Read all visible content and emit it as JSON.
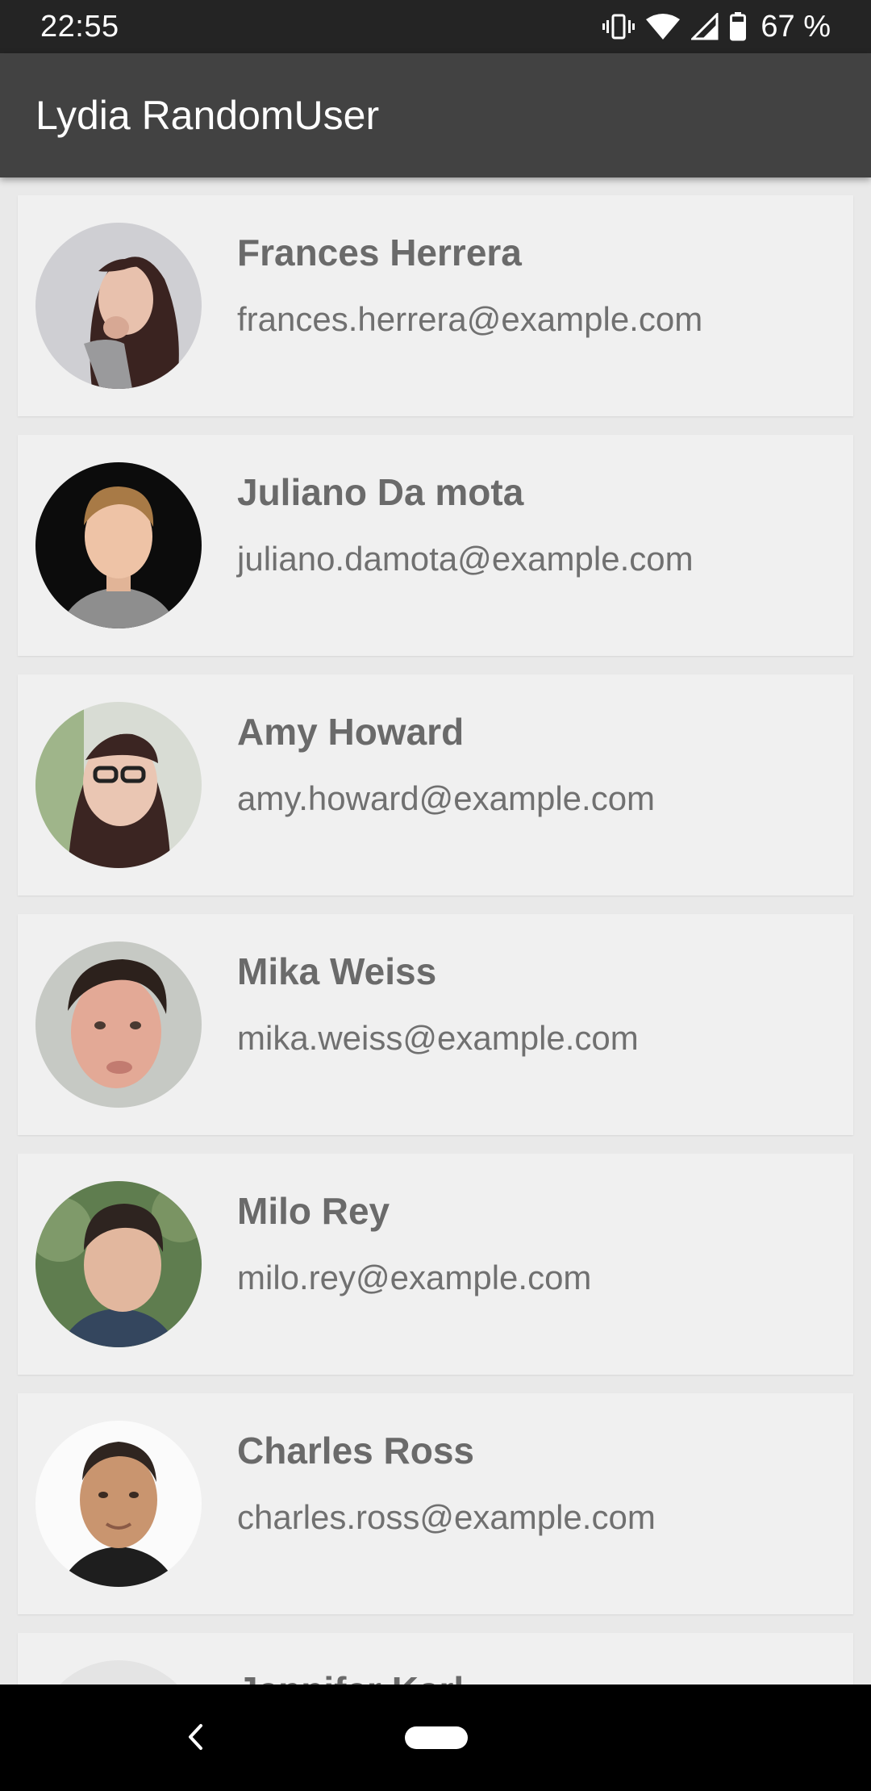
{
  "status_bar": {
    "time": "22:55",
    "battery": "67 %",
    "icons": [
      "vibrate-icon",
      "wifi-icon",
      "cell-signal-icon",
      "battery-icon"
    ]
  },
  "app_bar": {
    "title": "Lydia RandomUser"
  },
  "users": [
    {
      "name": "Frances Herrera",
      "email": "frances.herrera@example.com",
      "avatar": "avatar-photo"
    },
    {
      "name": "Juliano Da mota",
      "email": "juliano.damota@example.com",
      "avatar": "avatar-photo"
    },
    {
      "name": "Amy Howard",
      "email": "amy.howard@example.com",
      "avatar": "avatar-photo"
    },
    {
      "name": "Mika Weiss",
      "email": "mika.weiss@example.com",
      "avatar": "avatar-photo"
    },
    {
      "name": "Milo Rey",
      "email": "milo.rey@example.com",
      "avatar": "avatar-photo"
    },
    {
      "name": "Charles Ross",
      "email": "charles.ross@example.com",
      "avatar": "avatar-photo"
    },
    {
      "name": "Jennifer Karl",
      "email": "",
      "avatar": "avatar-photo"
    }
  ],
  "nav_bar": {
    "icons": [
      "back-icon",
      "home-pill-icon"
    ]
  },
  "colors": {
    "status_bar_bg": "#242424",
    "app_bar_bg": "#424242",
    "list_bg": "#e9e9e9",
    "card_bg": "#f0f0f0",
    "name_text": "#6a6a6a",
    "email_text": "#707070"
  }
}
